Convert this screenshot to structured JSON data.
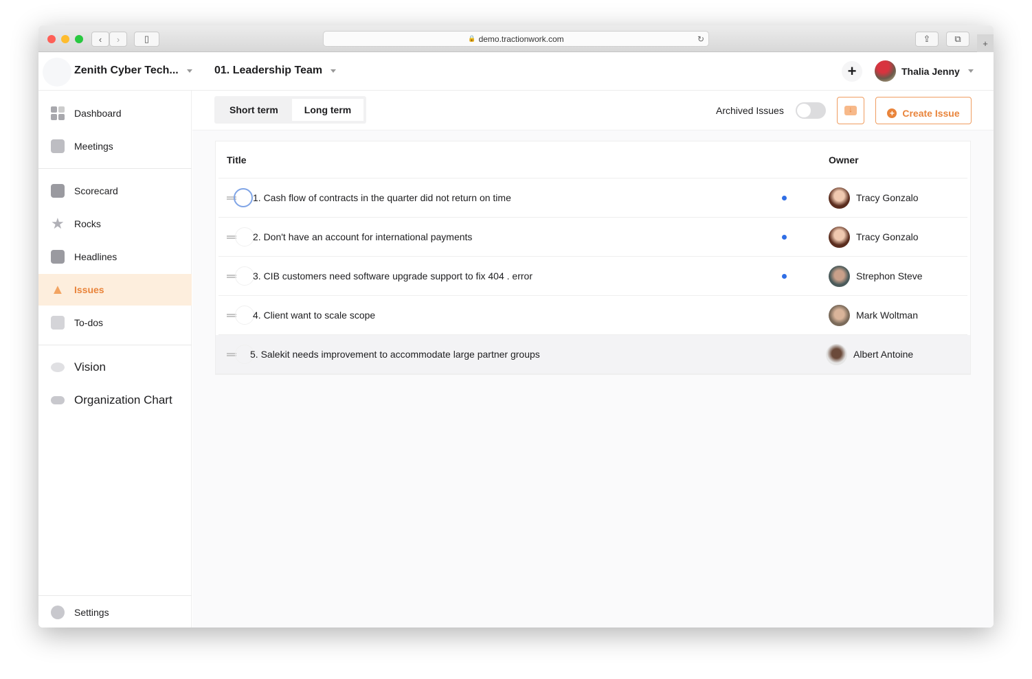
{
  "browser": {
    "url": "demo.tractionwork.com"
  },
  "header": {
    "company": "Zenith Cyber Tech...",
    "team": "01. Leadership Team",
    "user": "Thalia Jenny",
    "add_label": "+"
  },
  "sidebar": {
    "items": [
      {
        "label": "Dashboard",
        "icon": "dashboard-icon"
      },
      {
        "label": "Meetings",
        "icon": "calendar-icon"
      },
      {
        "label": "Scorecard",
        "icon": "chart-icon"
      },
      {
        "label": "Rocks",
        "icon": "star-icon"
      },
      {
        "label": "Headlines",
        "icon": "headline-icon"
      },
      {
        "label": "Issues",
        "icon": "warning-icon",
        "active": true
      },
      {
        "label": "To-dos",
        "icon": "pencil-icon"
      },
      {
        "label": "Vision",
        "icon": "eye-icon"
      },
      {
        "label": "Organization Chart",
        "icon": "people-icon"
      },
      {
        "label": "Settings",
        "icon": "gear-icon"
      }
    ]
  },
  "toolbar": {
    "tabs": [
      "Short term",
      "Long term"
    ],
    "active_tab": "Long term",
    "archived_label": "Archived Issues",
    "archived_on": false,
    "create_label": "Create Issue"
  },
  "table": {
    "headers": [
      "Title",
      "Owner"
    ],
    "rows": [
      {
        "title": "1. Cash flow of contracts in the quarter did not return on time",
        "owner": "Tracy Gonzalo",
        "dot": true
      },
      {
        "title": "2. Don't have an account for international payments",
        "owner": "Tracy Gonzalo",
        "dot": true
      },
      {
        "title": "3. CIB customers need software upgrade support to fix 404 . error",
        "owner": "Strephon Steve",
        "dot": true
      },
      {
        "title": "4. Client want to scale scope",
        "owner": "Mark Woltman",
        "dot": false
      },
      {
        "title": "5. Salekit needs improvement to accommodate large partner groups",
        "owner": "Albert Antoine",
        "dot": false
      }
    ]
  },
  "colors": {
    "accent": "#e9843b",
    "active_bg": "#fdeedd",
    "dot": "#2f6ee5"
  }
}
